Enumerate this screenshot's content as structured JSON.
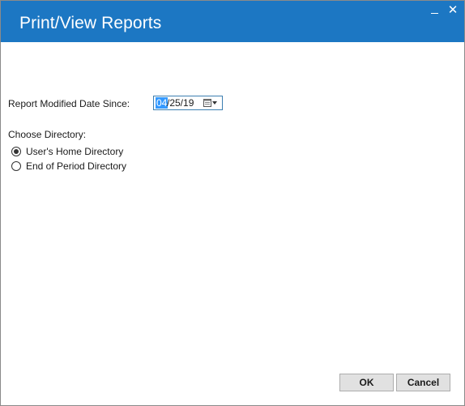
{
  "window": {
    "title": "Print/View Reports",
    "minimize_label": "_",
    "close_label": "✕"
  },
  "form": {
    "date_label": "Report Modified Date Since:",
    "date_value_selected": "04",
    "date_value_rest": "/25/19",
    "directory_label": "Choose Directory:",
    "options": [
      {
        "label": "User's Home Directory",
        "checked": true
      },
      {
        "label": "End of Period Directory",
        "checked": false
      }
    ]
  },
  "buttons": {
    "ok_label": "OK",
    "cancel_label": "Cancel"
  },
  "colors": {
    "titlebar": "#1c77c3",
    "selection": "#3399ff"
  }
}
